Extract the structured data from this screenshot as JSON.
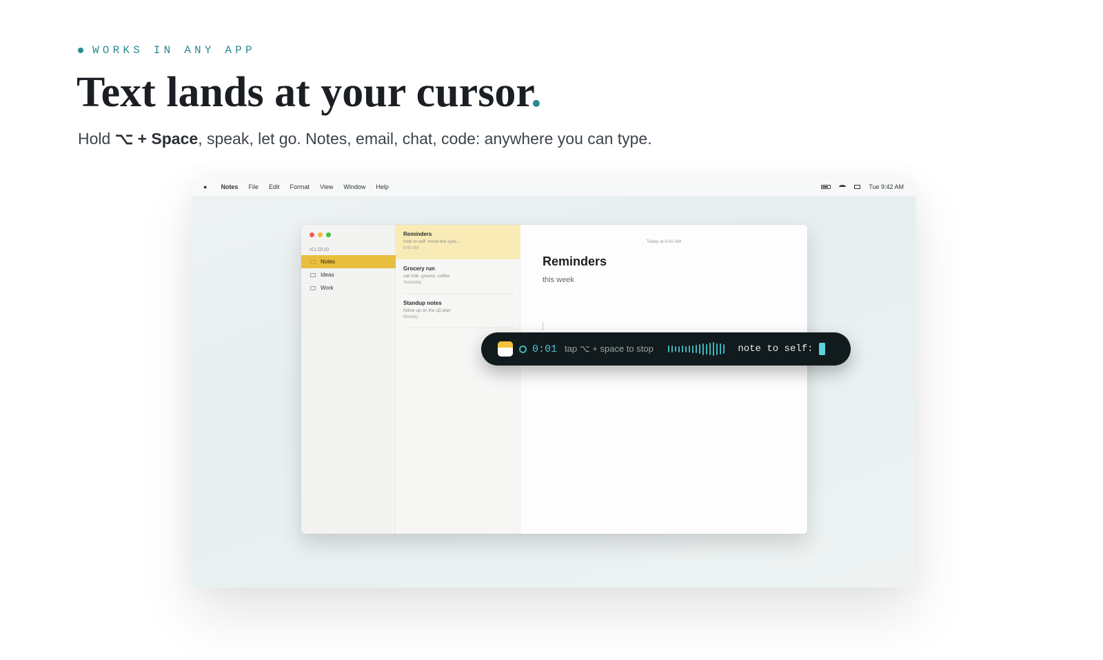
{
  "hero": {
    "eyebrow": "WORKS IN ANY APP",
    "headline": "Text lands at your cursor",
    "headline_accent": ".",
    "sub_prefix": "Hold ",
    "sub_shortcut": "⌥ + Space",
    "sub_suffix": ", speak, let go. Notes, email, chat, code: anywhere you can type."
  },
  "colors": {
    "accent": "#2a8a92",
    "folder_active": "#e8be3e",
    "note_active": "#f8ebb6",
    "pill_bg": "#111a1c",
    "wave": "#3fb4c0"
  },
  "menubar": {
    "apple_icon": "apple-icon",
    "app_name": "Notes",
    "items": [
      "File",
      "Edit",
      "Format",
      "View",
      "Window",
      "Help"
    ],
    "clock": "Tue 9:42 AM"
  },
  "sidebar": {
    "section": "ICLOUD",
    "folders": [
      {
        "label": "Notes",
        "active": true
      },
      {
        "label": "Ideas",
        "active": false
      },
      {
        "label": "Work",
        "active": false
      }
    ]
  },
  "notes": [
    {
      "title": "Reminders",
      "preview": "note to self: move the sync...",
      "date": "9:42 AM",
      "active": true
    },
    {
      "title": "Grocery run",
      "preview": "oat milk, greens, coffee",
      "date": "Yesterday",
      "active": false
    },
    {
      "title": "Standup notes",
      "preview": "follow up on the q3 plan",
      "date": "Monday",
      "active": false
    }
  ],
  "editor": {
    "date": "Today at 9:42 AM",
    "title": "Reminders",
    "body": "this week"
  },
  "dictation": {
    "timer": "0:01",
    "hint": "tap ⌥ + space to stop",
    "transcript": "note to self:",
    "waveform_levels": [
      0.5,
      0.5,
      0.4,
      0.45,
      0.5,
      0.45,
      0.5,
      0.55,
      0.6,
      0.7,
      0.85,
      0.75,
      0.9,
      1.0,
      0.85,
      0.8,
      0.7
    ]
  }
}
